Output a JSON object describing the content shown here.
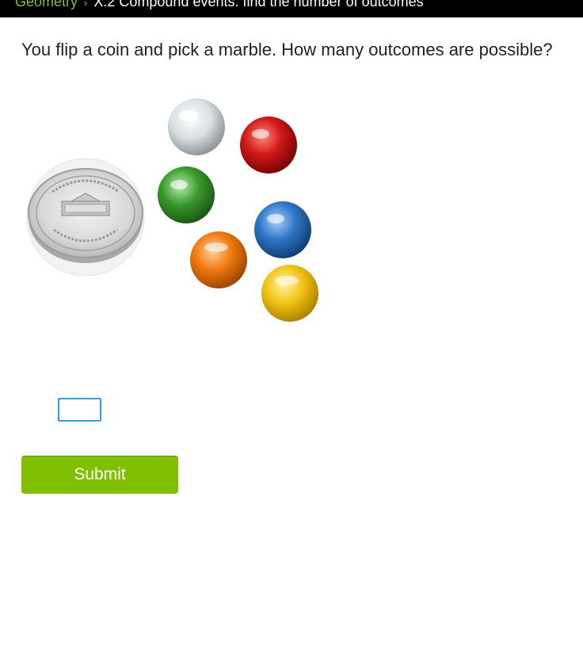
{
  "breadcrumb": {
    "subject": "Geometry",
    "separator": "›",
    "skill": "X.2 Compound events: find the number of outcomes"
  },
  "question": {
    "text": "You flip a coin and pick a marble. How many outcomes are possible?"
  },
  "illustration": {
    "coin": {
      "top_text": "E PLURIBUS UNUM",
      "bottom_text": "UNITED STATES OF AMERICA",
      "denomination": "FIVE CENTS",
      "building": "MONTICELLO"
    },
    "marble_colors": {
      "white": "#d8dee2",
      "red": "#d01818",
      "green": "#3a9a2c",
      "blue": "#2f76c8",
      "orange": "#f07a10",
      "yellow": "#f2c417"
    }
  },
  "answer": {
    "value": ""
  },
  "submit": {
    "label": "Submit"
  },
  "colors": {
    "accent": "#7fbf00",
    "link": "#7fbf3a",
    "input_border": "#2aa3e0"
  }
}
